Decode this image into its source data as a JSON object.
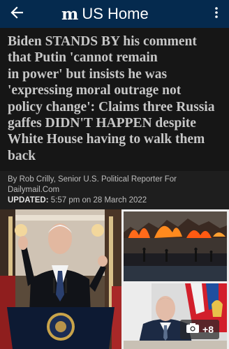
{
  "header": {
    "logo_text": "m",
    "title": "US Home",
    "background": "#052a4e",
    "back_icon": "back-arrow-icon",
    "menu_icon": "more-vertical-icon"
  },
  "article": {
    "headline_lines": [
      "Biden STANDS BY his comment",
      "that Putin 'cannot remain",
      "in power' but insists he was",
      "'expressing moral outrage not",
      "policy change': Claims three Russia",
      "gaffes DIDN'T HAPPEN despite",
      "White House having to walk them",
      "back"
    ],
    "byline_lines": [
      "By Rob Crilly, Senior U.S. Political Reporter For",
      "Dailymail.Com"
    ],
    "updated_label": "UPDATED:",
    "updated_value": " 5:57 pm on 28 March 2022"
  },
  "gallery": {
    "camera_icon": "camera-icon",
    "more_count": "+8"
  }
}
